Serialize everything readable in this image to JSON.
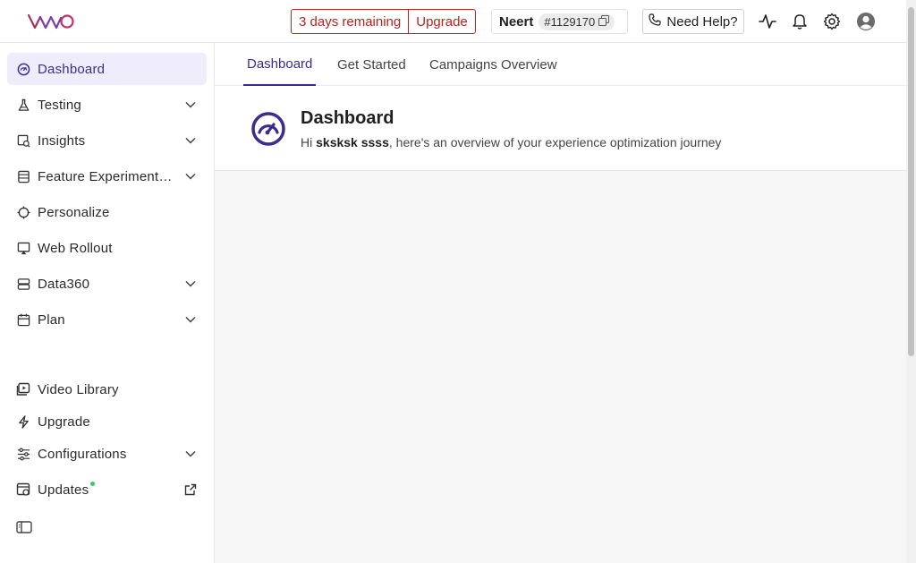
{
  "brand": {
    "logo_text": "VWO",
    "accent": "#3b2d8f",
    "alert": "#b3261e"
  },
  "header": {
    "trial_text": "3 days remaining",
    "upgrade_label": "Upgrade",
    "account_name": "Neert",
    "account_id": "#1129170",
    "help_label": "Need Help?"
  },
  "sidebar": {
    "items": [
      {
        "label": "Dashboard",
        "icon": "dashboard-icon",
        "active": true
      },
      {
        "label": "Testing",
        "icon": "flask-icon",
        "expandable": true
      },
      {
        "label": "Insights",
        "icon": "insights-icon",
        "expandable": true
      },
      {
        "label": "Feature Experimentation",
        "icon": "feature-icon",
        "expandable": true
      },
      {
        "label": "Personalize",
        "icon": "target-icon"
      },
      {
        "label": "Web Rollout",
        "icon": "rollout-icon"
      },
      {
        "label": "Data360",
        "icon": "database-icon",
        "expandable": true
      },
      {
        "label": "Plan",
        "icon": "calendar-icon",
        "expandable": true
      }
    ],
    "bottom_items": [
      {
        "label": "Video Library",
        "icon": "video-icon"
      },
      {
        "label": "Upgrade",
        "icon": "bolt-icon"
      },
      {
        "label": "Configurations",
        "icon": "sliders-icon",
        "expandable": true
      },
      {
        "label": "Updates",
        "icon": "updates-icon"
      }
    ]
  },
  "main": {
    "tabs": [
      {
        "label": "Dashboard",
        "active": true
      },
      {
        "label": "Get Started"
      },
      {
        "label": "Campaigns Overview"
      }
    ],
    "title": "Dashboard",
    "greeting_prefix": "Hi ",
    "user_name": "sksksk ssss",
    "greeting_suffix": ", here's an overview of your experience optimization journey"
  }
}
